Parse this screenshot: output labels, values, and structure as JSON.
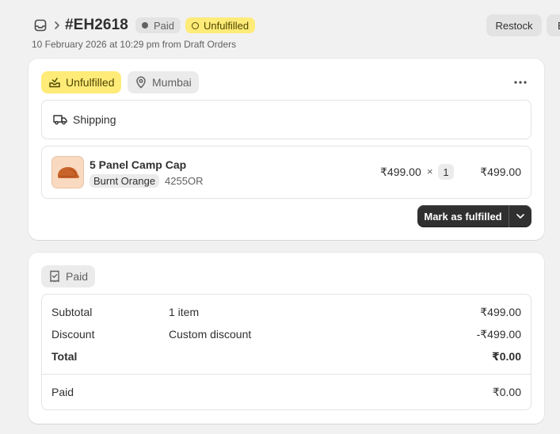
{
  "header": {
    "order_number": "#EH2618",
    "payment_badge": "Paid",
    "fulfillment_badge": "Unfulfilled",
    "subtitle": "10 February 2026 at 10:29 pm from Draft Orders",
    "restock_label": "Restock",
    "edit_label": "E"
  },
  "fulfillment_card": {
    "status_label": "Unfulfilled",
    "location_label": "Mumbai",
    "shipping_label": "Shipping",
    "item": {
      "name": "5 Panel Camp Cap",
      "variant": "Burnt Orange",
      "sku": "4255OR",
      "price": "₹499.00",
      "times": "×",
      "quantity": "1",
      "total": "₹499.00"
    },
    "mark_fulfilled_label": "Mark as fulfilled"
  },
  "payment_card": {
    "status_label": "Paid",
    "rows": [
      {
        "label": "Subtotal",
        "detail": "1 item",
        "amount": "₹499.00"
      },
      {
        "label": "Discount",
        "detail": "Custom discount",
        "amount": "-₹499.00"
      },
      {
        "label": "Total",
        "detail": "",
        "amount": "₹0.00"
      }
    ],
    "paid_row": {
      "label": "Paid",
      "amount": "₹0.00"
    }
  },
  "colors": {
    "unfulfilled_bg": "#ffeb78",
    "neutral_badge_bg": "#e3e3e3",
    "primary_button": "#303030"
  },
  "icons": {
    "order": "inbox-icon",
    "location": "map-pin-icon",
    "shipping": "truck-icon",
    "fulfillment": "package-check-icon",
    "payment": "receipt-icon",
    "more": "ellipsis-icon",
    "dropdown": "chevron-down-icon"
  }
}
